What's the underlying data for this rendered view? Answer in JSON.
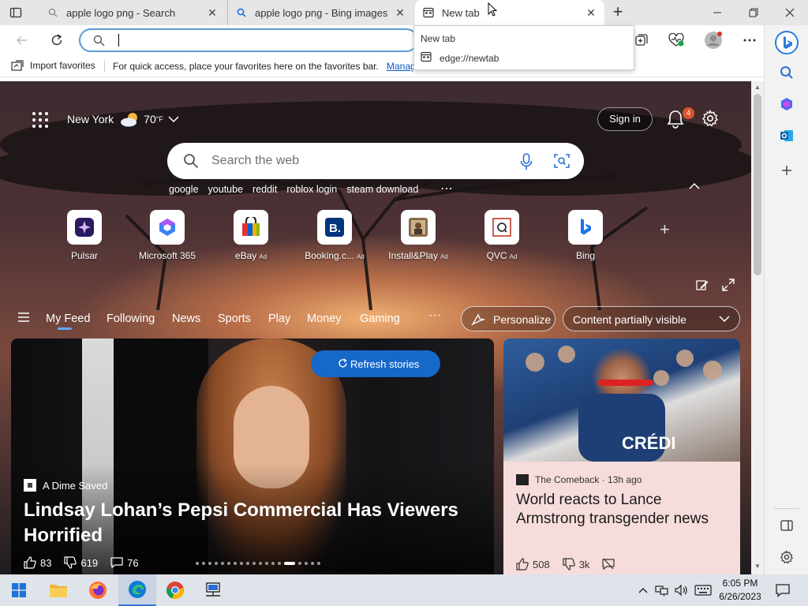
{
  "browser": {
    "tabs": [
      {
        "label": "apple logo png - Search",
        "icon": "search-icon"
      },
      {
        "label": "apple logo png - Bing images",
        "icon": "search-icon"
      },
      {
        "label": "New tab",
        "icon": "newtab-icon"
      }
    ],
    "address": {
      "value": "",
      "placeholder": ""
    },
    "hover_card": {
      "title": "New tab",
      "url": "edge://newtab"
    },
    "favorites": {
      "import_label": "Import favorites",
      "message": "For quick access, place your favorites here on the favorites bar.",
      "manage_link": "Manage favorites now"
    }
  },
  "newtab": {
    "weather": {
      "city": "New York",
      "temp": "70",
      "unit": "°F"
    },
    "sign_in": "Sign in",
    "notifications_count": "4",
    "search_placeholder": "Search the web",
    "trending": [
      "google",
      "youtube",
      "reddit",
      "roblox login",
      "steam download"
    ],
    "quick_links": [
      {
        "label": "Pulsar",
        "ad": ""
      },
      {
        "label": "Microsoft 365",
        "ad": ""
      },
      {
        "label": "eBay",
        "ad": "Ad"
      },
      {
        "label": "Booking.c...",
        "ad": "Ad"
      },
      {
        "label": "Install&Play",
        "ad": "Ad"
      },
      {
        "label": "QVC",
        "ad": "Ad"
      },
      {
        "label": "Bing",
        "ad": ""
      }
    ],
    "feed_tabs": [
      "My Feed",
      "Following",
      "News",
      "Sports",
      "Play",
      "Money",
      "Gaming"
    ],
    "more": "···",
    "personalize": "Personalize",
    "content_visibility": "Content partially visible",
    "refresh": "Refresh stories",
    "main_story": {
      "source": "A Dime Saved",
      "headline": "Lindsay Lohan’s Pepsi Commercial Has Viewers Horrified",
      "likes": "83",
      "dislikes": "619",
      "comments": "76"
    },
    "side_story": {
      "source": "The Comeback · 13h ago",
      "headline": "World reacts to Lance Armstrong transgender news",
      "likes": "508",
      "dislikes": "3k"
    }
  },
  "taskbar": {
    "time": "6:05 PM",
    "date": "6/26/2023"
  },
  "colors": {
    "accent": "#1668c9",
    "badge": "#d9562b",
    "taskbar": "#dfe3ea"
  }
}
